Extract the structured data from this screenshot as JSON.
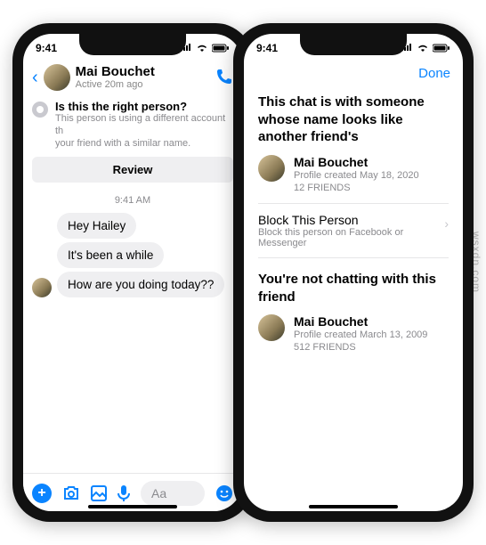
{
  "statusbar": {
    "time": "9:41"
  },
  "left": {
    "header": {
      "name": "Mai Bouchet",
      "active": "Active 20m ago"
    },
    "warning": {
      "title": "Is this the right person?",
      "body_a": "This person is using a different account th",
      "body_b": "your friend with a similar name."
    },
    "review": "Review",
    "timestamp": "9:41 AM",
    "messages": [
      "Hey Hailey",
      "It's been a while",
      "How are you doing today??"
    ],
    "composer_placeholder": "Aa"
  },
  "right": {
    "done": "Done",
    "heading1": "This chat is with someone whose name looks like another friend's",
    "stranger": {
      "name": "Mai Bouchet",
      "created": "Profile created May 18, 2020",
      "friends": "12 FRIENDS"
    },
    "block": {
      "title": "Block This Person",
      "sub": "Block this person on Facebook or Messenger"
    },
    "heading2": "You're not chatting with this friend",
    "friend": {
      "name": "Mai Bouchet",
      "created": "Profile created March 13, 2009",
      "friends": "512 FRIENDS"
    }
  },
  "watermark": "wsxdn.com"
}
